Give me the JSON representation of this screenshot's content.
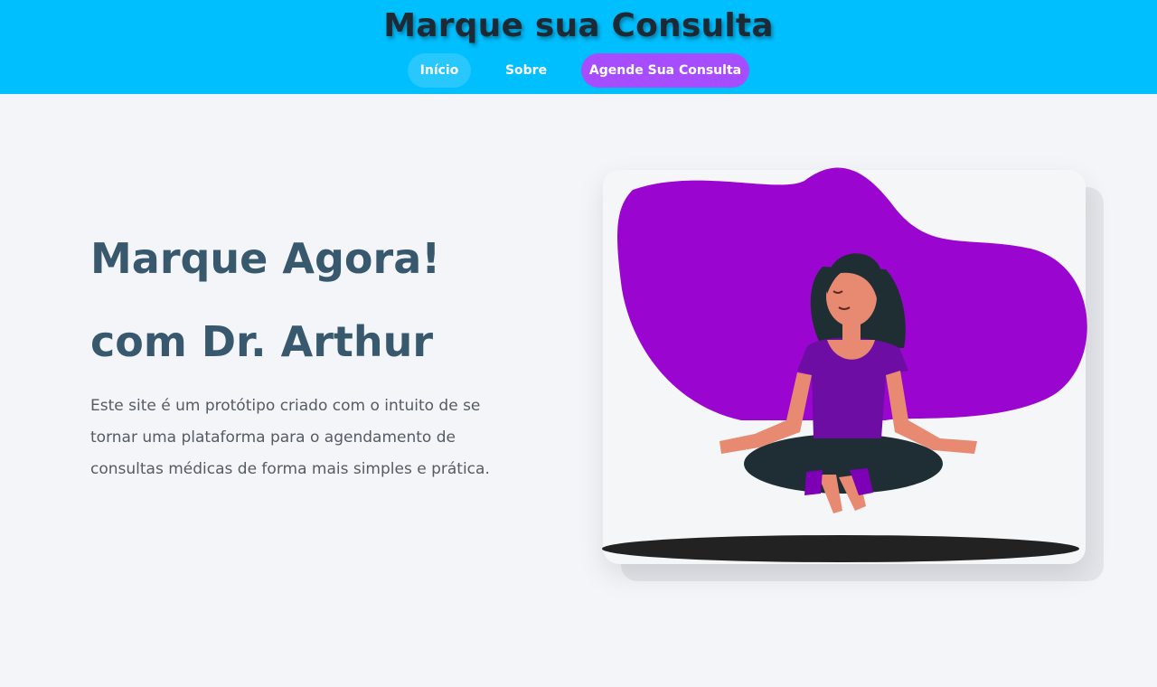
{
  "header": {
    "title": "Marque sua Consulta",
    "nav": [
      {
        "label": "Início",
        "active": true
      },
      {
        "label": "Sobre",
        "active": false
      },
      {
        "label": "Agende Sua Consulta",
        "active": false
      }
    ]
  },
  "hero": {
    "title": "Marque Agora!",
    "subtitle": "com Dr. Arthur",
    "description": "Este site é um protótipo criado com o intuito de se tornar uma plataforma para o agendamento de consultas médicas de forma mais simples e prática."
  },
  "colors": {
    "header_bg": "#00bfff",
    "accent_purple": "#a64dff",
    "title_text": "#38586d",
    "blob": "#9b05d0"
  },
  "icons": {
    "illustration": "meditating-woman-illustration"
  }
}
